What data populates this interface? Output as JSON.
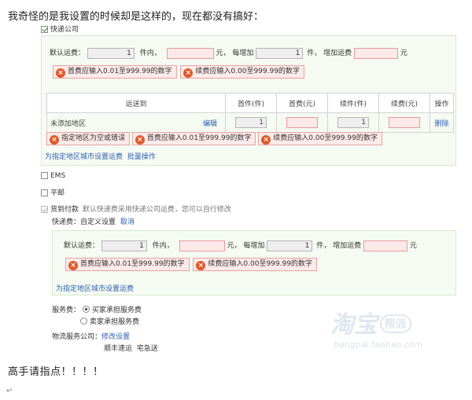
{
  "question": "我奇怪的是我设置的时候却是这样的，现在都没有搞好：",
  "closing": "高手请指点！！！！",
  "pilcrow": "↵",
  "express": {
    "label": "快递公司",
    "default_fee_label": "默认运费：",
    "first_qty": "1",
    "unit_within": "件内，",
    "yuan": "元，",
    "each_add": "每增加",
    "add_qty": "1",
    "unit_add": "件，",
    "add_fee_label": "增加运费",
    "yuan2": "元",
    "errors": [
      "首费应输入0.01至999.99的数字",
      "续费应输入0.00至999.99的数字"
    ],
    "table": {
      "headers": [
        "运送到",
        "首件(件)",
        "首费(元)",
        "续件(件)",
        "续费(元)",
        "操作"
      ],
      "row": {
        "region": "未添加地区",
        "edit": "编辑",
        "first_qty": "1",
        "add_qty": "1",
        "delete": "删除"
      }
    },
    "row_errors": [
      "指定地区为空或错误",
      "首费应输入0.01至999.99的数字",
      "续费应输入0.00至999.99的数字"
    ],
    "links": {
      "region_fee": "为指定地区城市设置运费",
      "batch": "批量操作"
    }
  },
  "ems": {
    "label": "EMS"
  },
  "post": {
    "label": "平邮"
  },
  "cod": {
    "label": "货到付款",
    "note": "默认快递费采用快递公司运费，您可以自行修改",
    "fee_label": "快递费：",
    "fee_value": "自定义设置",
    "cancel": "取消",
    "default_fee_label": "默认运费：",
    "first_qty": "1",
    "unit_within": "件内，",
    "yuan": "元，",
    "each_add": "每增加",
    "add_qty": "1",
    "unit_add": "件，",
    "add_fee_label": "增加运费",
    "yuan2": "元",
    "errors": [
      "首费应输入0.01至999.99的数字",
      "续费应输入0.00至999.99的数字"
    ],
    "region_link": "为指定地区城市设置运费"
  },
  "service": {
    "label": "服务费：",
    "options": [
      "买家承担服务费",
      "卖家承担服务费"
    ],
    "selected": 0
  },
  "logistics": {
    "label": "物流服务公司：",
    "modify": "修改设置",
    "companies": "顺丰速运  宅急送"
  },
  "watermark": {
    "main": "淘宝",
    "badge": "帮派",
    "url": "bangpai.taobao.com"
  }
}
